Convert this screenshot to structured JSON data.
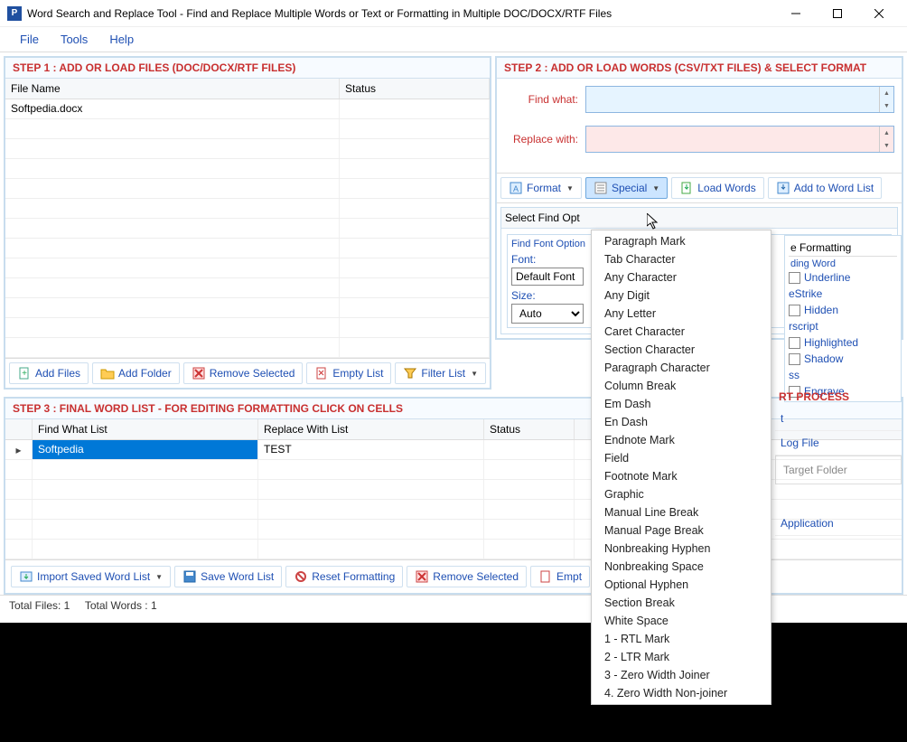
{
  "window": {
    "title": "Word Search and Replace Tool - Find and Replace Multiple Words or Text  or Formatting in Multiple DOC/DOCX/RTF Files"
  },
  "menubar": [
    "File",
    "Tools",
    "Help"
  ],
  "step1": {
    "header": "STEP 1 : ADD OR LOAD FILES (DOC/DOCX/RTF FILES)",
    "col_filename": "File Name",
    "col_status": "Status",
    "rows": [
      {
        "filename": "Softpedia.docx",
        "status": ""
      }
    ],
    "toolbar": {
      "add_files": "Add Files",
      "add_folder": "Add Folder",
      "remove_selected": "Remove Selected",
      "empty_list": "Empty List",
      "filter_list": "Filter List"
    }
  },
  "step2": {
    "header": "STEP 2 : ADD OR LOAD WORDS (CSV/TXT FILES) & SELECT FORMAT",
    "find_label": "Find what:",
    "replace_label": "Replace with:",
    "find_value": "",
    "replace_value": "",
    "toolbar": {
      "format": "Format",
      "special": "Special",
      "load_words": "Load Words",
      "add_to_word_list": "Add to Word List"
    },
    "options": {
      "header": "Select Find Opt",
      "font_group": "Find Font Option",
      "font_label": "Font:",
      "font_value": "Default Font",
      "size_label": "Size:",
      "size_value": "Auto"
    },
    "formatting": {
      "header": "e Formatting",
      "subheader": "ding Word",
      "partial1": "eStrike",
      "partial2": "rscript",
      "partial3": "ss",
      "underline": "Underline",
      "hidden": "Hidden",
      "highlighted": "Highlighted",
      "shadow": "Shadow",
      "engrave": "Engrave"
    }
  },
  "special_menu": [
    "Paragraph Mark",
    "Tab Character",
    "Any Character",
    "Any Digit",
    "Any Letter",
    "Caret Character",
    "Section Character",
    "Paragraph Character",
    "Column Break",
    "Em Dash",
    "En Dash",
    "Endnote Mark",
    "Field",
    "Footnote Mark",
    "Graphic",
    "Manual Line Break",
    "Manual Page Break",
    "Nonbreaking Hyphen",
    "Nonbreaking Space",
    "Optional Hyphen",
    "Section Break",
    "White Space",
    "1 - RTL Mark",
    "2 - LTR Mark",
    "3 - Zero Width Joiner",
    "4. Zero Width Non-joiner"
  ],
  "step3": {
    "header": "STEP 3 : FINAL WORD LIST - FOR EDITING FORMATTING CLICK ON CELLS",
    "col_find": "Find What List",
    "col_replace": "Replace With List",
    "col_status": "Status",
    "rows": [
      {
        "find": "Softpedia",
        "replace": "TEST",
        "status": ""
      }
    ],
    "toolbar": {
      "import": "Import Saved Word List",
      "save": "Save Word List",
      "reset": "Reset Formatting",
      "remove": "Remove Selected",
      "empty": "Empt"
    }
  },
  "process": {
    "header": "RT PROCESS",
    "btn1": "t",
    "log_file": "Log File",
    "target": "Target Folder",
    "application": "Application"
  },
  "statusbar": {
    "files": "Total Files: 1",
    "words": "Total Words : 1"
  }
}
